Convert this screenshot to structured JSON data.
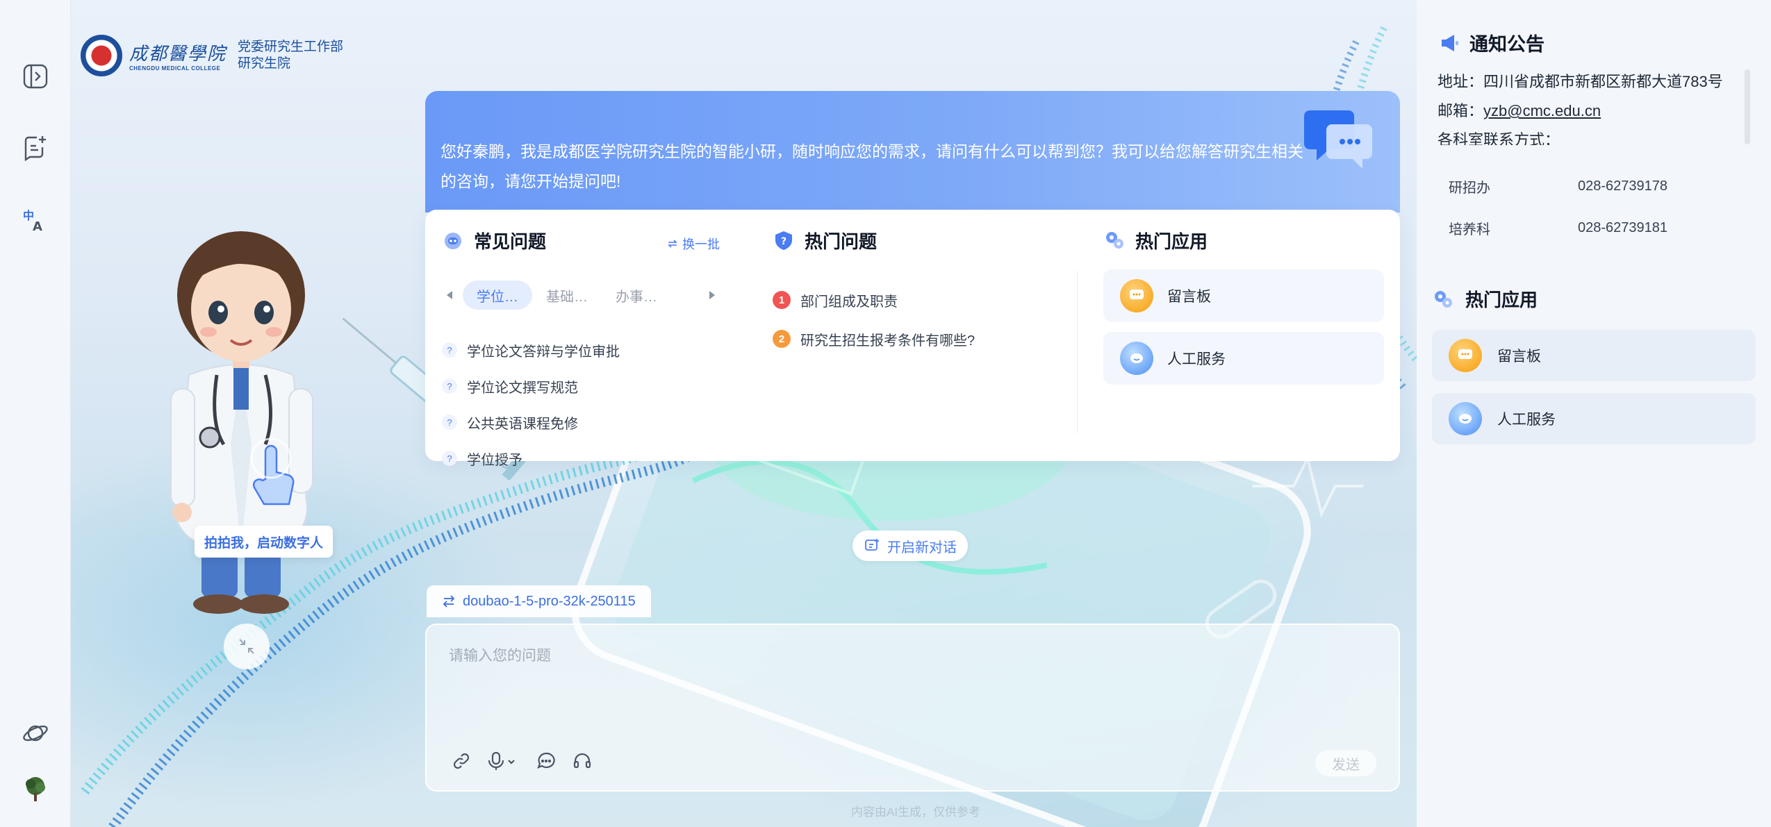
{
  "rail": {
    "icons": [
      "sidebar-toggle-icon",
      "new-chat-icon",
      "translate-icon",
      "planet-icon",
      "tree-avatar-icon"
    ]
  },
  "logo": {
    "name_cn": "成都醫學院",
    "name_en": "CHENGDU MEDICAL COLLEGE",
    "dept_line1": "党委研究生工作部",
    "dept_line2": "研究生院"
  },
  "welcome": {
    "text": "您好秦鹏，我是成都医学院研究生院的智能小研，随时响应您的需求，请问有什么可以帮到您？我可以给您解答研究生相关的咨询，请您开始提问吧!"
  },
  "faq": {
    "title": "常见问题",
    "refresh_label": "换一批",
    "tabs": [
      "学位…",
      "基础…",
      "办事…"
    ],
    "active_tab": 0,
    "items": [
      "学位论文答辩与学位审批",
      "学位论文撰写规范",
      "公共英语课程免修",
      "学位授予"
    ]
  },
  "hot_questions": {
    "title": "热门问题",
    "items": [
      {
        "rank": "1",
        "text": "部门组成及职责",
        "color": "#f05454"
      },
      {
        "rank": "2",
        "text": "研究生招生报考条件有哪些?",
        "color": "#f59a3c"
      }
    ]
  },
  "hot_apps": {
    "title": "热门应用",
    "items": [
      "留言板",
      "人工服务"
    ]
  },
  "avatar": {
    "tap_label": "拍拍我，启动数字人"
  },
  "new_chat_label": "开启新对话",
  "model_name": "doubao-1-5-pro-32k-250115",
  "input": {
    "placeholder": "请输入您的问题",
    "value": "",
    "send_label": "发送"
  },
  "footer_note": "内容由AI生成，仅供参考",
  "right_panel": {
    "notice_title": "通知公告",
    "address": "地址：四川省成都市新都区新都大道783号",
    "email_label": "邮箱：",
    "email": "yzb@cmc.edu.cn",
    "contact_label": "各科室联系方式：",
    "contacts": [
      {
        "office": "研招办",
        "phone": "028-62739178"
      },
      {
        "office": "培养科",
        "phone": "028-62739181"
      }
    ],
    "apps_title": "热门应用",
    "apps": [
      "留言板",
      "人工服务"
    ]
  },
  "colors": {
    "accent": "#4a7cf2",
    "welcome_gradient_start": "#6a99f7",
    "welcome_gradient_end": "#9cc0fa",
    "rail_bg": "#f3f6fb"
  }
}
